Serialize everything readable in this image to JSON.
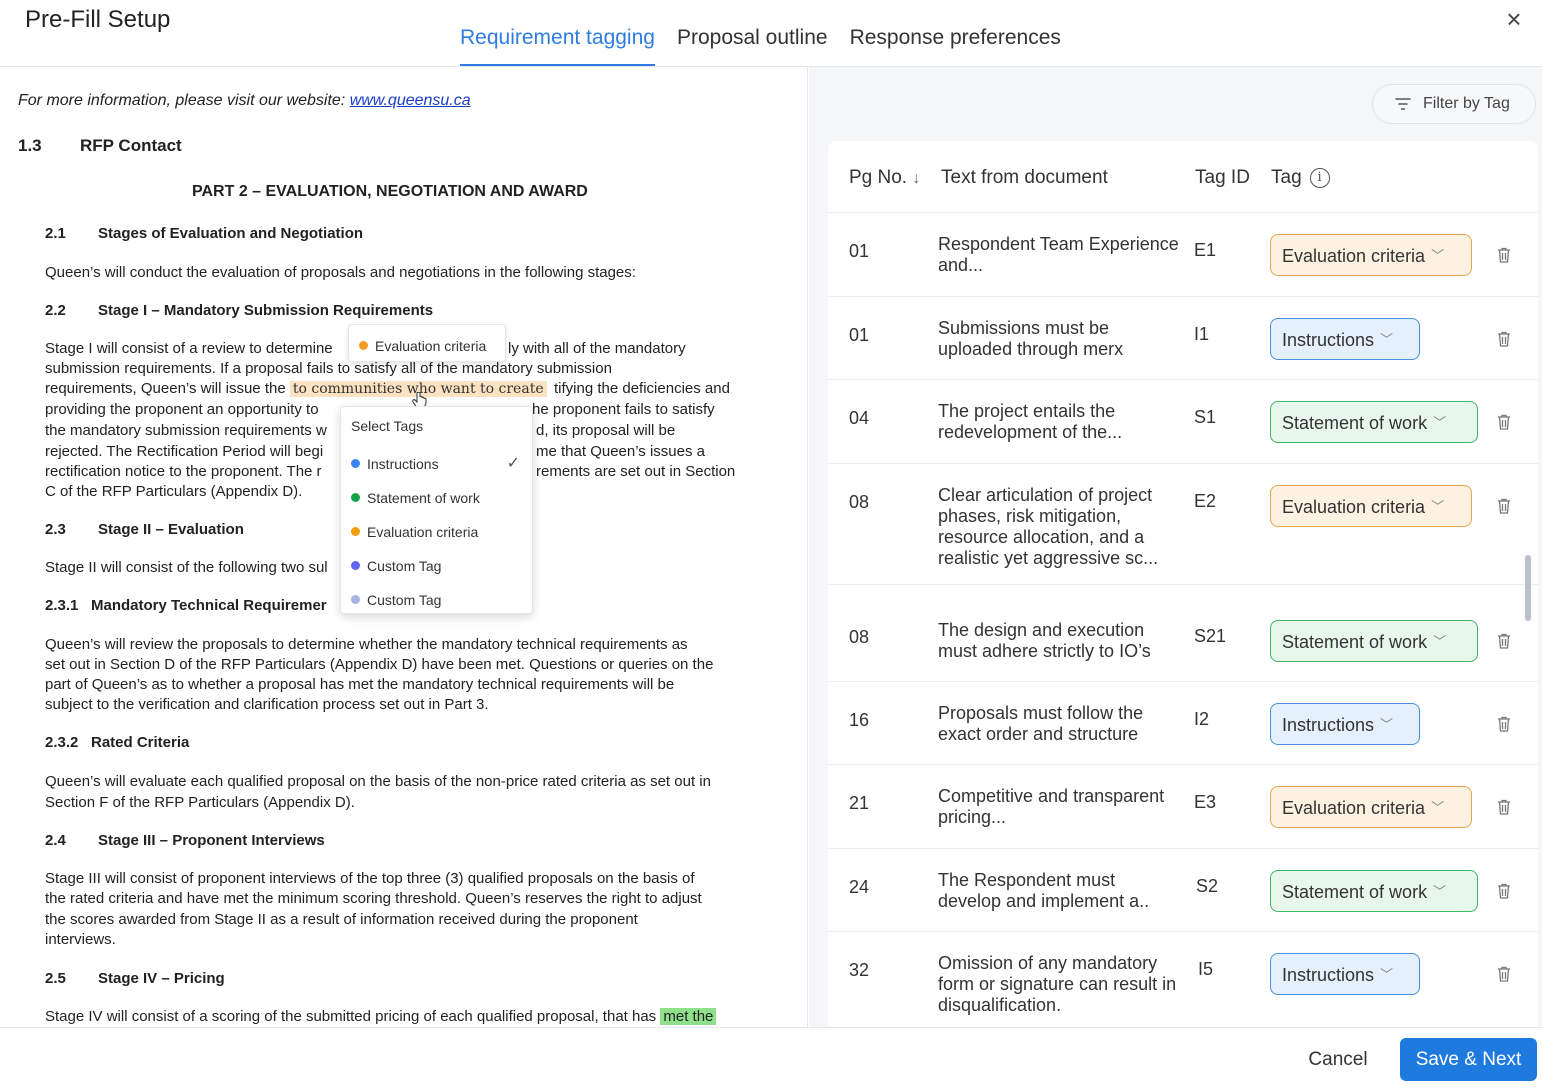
{
  "app": {
    "title": "Pre-Fill Setup",
    "close": "×"
  },
  "tabs": [
    {
      "label": "Requirement tagging"
    },
    {
      "label": "Proposal outline"
    },
    {
      "label": "Response preferences"
    }
  ],
  "doc": {
    "info_prefix": "For more information, please visit our website: ",
    "info_link": "www.queensu.ca",
    "s13_num": "1.3",
    "s13_title": "RFP Contact",
    "part2": "PART 2 – EVALUATION, NEGOTIATION AND AWARD",
    "s21_num": "2.1",
    "s21_title": "Stages of Evaluation and Negotiation",
    "s21_body": "Queen’s will conduct the evaluation of proposals and negotiations in the following stages:",
    "s22_num": "2.2",
    "s22_title": "Stage I – Mandatory Submission Requirements",
    "s22_l1a": "Stage I will consist of a review to determine",
    "s22_l1b": "ly with all of the mandatory",
    "s22_l2": "submission requirements. If a proposal fails to satisfy all of the mandatory submission",
    "s22_l3a": "requirements, Queen’s will issue the",
    "s22_l3_hl": "to communities who want to create",
    "s22_l3b": "tifying the deficiencies and",
    "s22_l4a": "providing the proponent an opportunity to",
    "s22_l4b": "he proponent fails to satisfy",
    "s22_l5a": "the mandatory submission requirements w",
    "s22_l5b": "d, its proposal will be",
    "s22_l6a": "rejected. The Rectification Period will begi",
    "s22_l6b": "me that Queen’s issues a",
    "s22_l7a": "rectification notice to the proponent. The r",
    "s22_l7b": "rements are set out in Section",
    "s22_l8": "C of the RFP Particulars (Appendix D).",
    "s23_num": "2.3",
    "s23_title": "Stage II – Evaluation",
    "s23_body": "Stage II will consist of the following two sul",
    "s231_num": "2.3.1",
    "s231_title": "Mandatory Technical Requiremer",
    "s231_l1": "Queen’s will review the proposals to determine whether the mandatory technical requirements as",
    "s231_l2": "set out in Section D of the RFP Particulars (Appendix D) have been met. Questions or queries on the",
    "s231_l3": "part of Queen’s as to whether a proposal has met the mandatory technical requirements will be",
    "s231_l4": "subject to the verification and clarification process set out in Part 3.",
    "s232_num": "2.3.2",
    "s232_title": "Rated Criteria",
    "s232_l1": "Queen’s will evaluate each qualified proposal on the basis of the non-price rated criteria as set out in",
    "s232_l2": "Section F of the RFP Particulars (Appendix D).",
    "s24_num": "2.4",
    "s24_title": "Stage III – Proponent Interviews",
    "s24_l1": "Stage III will consist of proponent interviews of the top three (3) qualified proposals on the basis of",
    "s24_l2": "the rated criteria and have met the minimum scoring threshold. Queen’s reserves the right to adjust",
    "s24_l3": "the scores awarded from Stage II as a result of information received during the proponent",
    "s24_l4": "interviews.",
    "s25_num": "2.5",
    "s25_title": "Stage IV – Pricing",
    "s25_l1": "Stage IV will consist of a scoring of the submitted pricing of each qualified proposal, that has",
    "s25_l1_hl": "met the"
  },
  "chip_popup": {
    "label": "Evaluation criteria",
    "color": "#f39c1f"
  },
  "tag_menu": {
    "heading": "Select Tags",
    "items": [
      {
        "label": "Instructions",
        "color": "#3b82f6",
        "selected": true
      },
      {
        "label": "Statement of work",
        "color": "#16a34a"
      },
      {
        "label": "Evaluation criteria",
        "color": "#f59e0b"
      },
      {
        "label": "Custom Tag",
        "color": "#6366f1"
      },
      {
        "label": "Custom Tag",
        "color": "#a5b4e0"
      }
    ]
  },
  "filter": {
    "label": "Filter by Tag"
  },
  "table": {
    "headers": {
      "pg": "Pg No.",
      "pg_sort": "↓",
      "text": "Text from document",
      "tagid": "Tag ID",
      "tag": "Tag",
      "info": "i"
    },
    "rows": [
      {
        "pg": "01",
        "text": "Respondent Team Experience and...",
        "tag_id": "E1",
        "tag": "Evaluation criteria"
      },
      {
        "pg": "01",
        "text": "Submissions must be uploaded through merx",
        "tag_id": "I1",
        "tag": "Instructions"
      },
      {
        "pg": "04",
        "text": "The project entails the redevelopment of the...",
        "tag_id": "S1",
        "tag": "Statement of work"
      },
      {
        "pg": "08",
        "text": "Clear articulation of project phases, risk mitigation, resource allocation, and a realistic yet aggressive sc...",
        "tag_id": "E2",
        "tag": "Evaluation criteria"
      },
      {
        "pg": "08",
        "text": "The design and execution must adhere strictly to IO’s",
        "tag_id": "S21",
        "tag": "Statement of work"
      },
      {
        "pg": "16",
        "text": "Proposals must follow the exact order and structure",
        "tag_id": "I2",
        "tag": "Instructions"
      },
      {
        "pg": "21",
        "text": "Competitive and transparent pricing...",
        "tag_id": "E3",
        "tag": "Evaluation criteria"
      },
      {
        "pg": "24",
        "text": "The Respondent must develop and implement a..",
        "tag_id": "S2",
        "tag": "Statement of work"
      },
      {
        "pg": "32",
        "text": "Omission of any mandatory form or signature can result in disqualification.",
        "tag_id": "I5",
        "tag": "Instructions"
      }
    ]
  },
  "footer": {
    "cancel": "Cancel",
    "save": "Save & Next"
  },
  "colors": {
    "accent": "#1f7ae0",
    "eval_border": "#e6a64c",
    "instr_border": "#4a90e2",
    "sow_border": "#3fb766"
  }
}
